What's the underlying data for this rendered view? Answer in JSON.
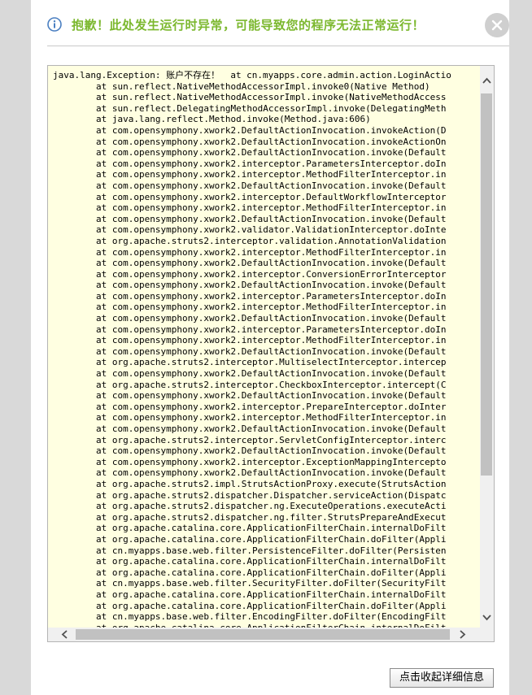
{
  "dialog": {
    "title": "抱歉！此处发生运行时异常，可能导致您的程序无法正常运行！",
    "details_button": "点击收起详细信息"
  },
  "icons": {
    "info": "info-icon",
    "close": "close-icon"
  },
  "colors": {
    "title": "#7cb82f",
    "trace_background": "#ffffe1",
    "side_panel": "#d9d9d9"
  },
  "stack_trace": [
    "java.lang.Exception: 账户不存在！  at cn.myapps.core.admin.action.LoginActio",
    "        at sun.reflect.NativeMethodAccessorImpl.invoke0(Native Method)",
    "        at sun.reflect.NativeMethodAccessorImpl.invoke(NativeMethodAccess",
    "        at sun.reflect.DelegatingMethodAccessorImpl.invoke(DelegatingMeth",
    "        at java.lang.reflect.Method.invoke(Method.java:606)",
    "        at com.opensymphony.xwork2.DefaultActionInvocation.invokeAction(D",
    "        at com.opensymphony.xwork2.DefaultActionInvocation.invokeActionOn",
    "        at com.opensymphony.xwork2.DefaultActionInvocation.invoke(Default",
    "        at com.opensymphony.xwork2.interceptor.ParametersInterceptor.doIn",
    "        at com.opensymphony.xwork2.interceptor.MethodFilterInterceptor.in",
    "        at com.opensymphony.xwork2.DefaultActionInvocation.invoke(Default",
    "        at com.opensymphony.xwork2.interceptor.DefaultWorkflowInterceptor",
    "        at com.opensymphony.xwork2.interceptor.MethodFilterInterceptor.in",
    "        at com.opensymphony.xwork2.DefaultActionInvocation.invoke(Default",
    "        at com.opensymphony.xwork2.validator.ValidationInterceptor.doInte",
    "        at org.apache.struts2.interceptor.validation.AnnotationValidation",
    "        at com.opensymphony.xwork2.interceptor.MethodFilterInterceptor.in",
    "        at com.opensymphony.xwork2.DefaultActionInvocation.invoke(Default",
    "        at com.opensymphony.xwork2.interceptor.ConversionErrorInterceptor",
    "        at com.opensymphony.xwork2.DefaultActionInvocation.invoke(Default",
    "        at com.opensymphony.xwork2.interceptor.ParametersInterceptor.doIn",
    "        at com.opensymphony.xwork2.interceptor.MethodFilterInterceptor.in",
    "        at com.opensymphony.xwork2.DefaultActionInvocation.invoke(Default",
    "        at com.opensymphony.xwork2.interceptor.ParametersInterceptor.doIn",
    "        at com.opensymphony.xwork2.interceptor.MethodFilterInterceptor.in",
    "        at com.opensymphony.xwork2.DefaultActionInvocation.invoke(Default",
    "        at org.apache.struts2.interceptor.MultiselectInterceptor.intercep",
    "        at com.opensymphony.xwork2.DefaultActionInvocation.invoke(Default",
    "        at org.apache.struts2.interceptor.CheckboxInterceptor.intercept(C",
    "        at com.opensymphony.xwork2.DefaultActionInvocation.invoke(Default",
    "        at com.opensymphony.xwork2.interceptor.PrepareInterceptor.doInter",
    "        at com.opensymphony.xwork2.interceptor.MethodFilterInterceptor.in",
    "        at com.opensymphony.xwork2.DefaultActionInvocation.invoke(Default",
    "        at org.apache.struts2.interceptor.ServletConfigInterceptor.interc",
    "        at com.opensymphony.xwork2.DefaultActionInvocation.invoke(Default",
    "        at com.opensymphony.xwork2.interceptor.ExceptionMappingIntercepto",
    "        at com.opensymphony.xwork2.DefaultActionInvocation.invoke(Default",
    "        at org.apache.struts2.impl.StrutsActionProxy.execute(StrutsAction",
    "        at org.apache.struts2.dispatcher.Dispatcher.serviceAction(Dispatc",
    "        at org.apache.struts2.dispatcher.ng.ExecuteOperations.executeActi",
    "        at org.apache.struts2.dispatcher.ng.filter.StrutsPrepareAndExecut",
    "        at org.apache.catalina.core.ApplicationFilterChain.internalDoFilt",
    "        at org.apache.catalina.core.ApplicationFilterChain.doFilter(Appli",
    "        at cn.myapps.base.web.filter.PersistenceFilter.doFilter(Persisten",
    "        at org.apache.catalina.core.ApplicationFilterChain.internalDoFilt",
    "        at org.apache.catalina.core.ApplicationFilterChain.doFilter(Appli",
    "        at cn.myapps.base.web.filter.SecurityFilter.doFilter(SecurityFilt",
    "        at org.apache.catalina.core.ApplicationFilterChain.internalDoFilt",
    "        at org.apache.catalina.core.ApplicationFilterChain.doFilter(Appli",
    "        at cn.myapps.base.web.filter.EncodingFilter.doFilter(EncodingFilt",
    "        at org.apache.catalina.core.ApplicationFilterChain.internalDoFilt"
  ]
}
